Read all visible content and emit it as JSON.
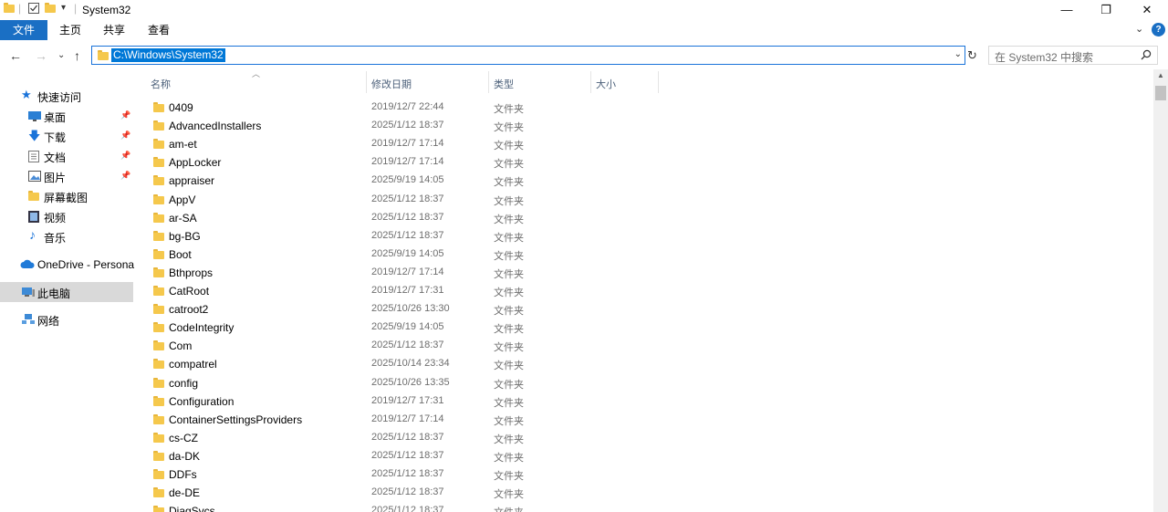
{
  "window": {
    "title": "System32",
    "minimize_glyph": "—",
    "maximize_glyph": "❐",
    "close_glyph": "✕"
  },
  "ribbon": {
    "tabs": [
      "文件",
      "主页",
      "共享",
      "查看"
    ],
    "help_label": "?"
  },
  "address": {
    "path": "C:\\Windows\\System32",
    "search_placeholder": "在 System32 中搜索"
  },
  "sidebar": {
    "items": [
      {
        "label": "快速访问",
        "icon": "star-icon"
      },
      {
        "label": "桌面",
        "icon": "desktop-icon",
        "pinned": true
      },
      {
        "label": "下载",
        "icon": "download-icon",
        "pinned": true
      },
      {
        "label": "文档",
        "icon": "document-icon",
        "pinned": true
      },
      {
        "label": "图片",
        "icon": "picture-icon",
        "pinned": true
      },
      {
        "label": "屏幕截图",
        "icon": "folder-icon"
      },
      {
        "label": "视频",
        "icon": "video-icon"
      },
      {
        "label": "音乐",
        "icon": "music-icon"
      },
      {
        "label": "OneDrive - Persona",
        "icon": "cloud-icon"
      },
      {
        "label": "此电脑",
        "icon": "computer-icon",
        "selected": true
      },
      {
        "label": "网络",
        "icon": "network-icon"
      }
    ]
  },
  "columns": [
    "名称",
    "修改日期",
    "类型",
    "大小"
  ],
  "files": [
    {
      "name": "0409",
      "date": "2019/12/7 22:44",
      "type": "文件夹"
    },
    {
      "name": "AdvancedInstallers",
      "date": "2025/1/12 18:37",
      "type": "文件夹"
    },
    {
      "name": "am-et",
      "date": "2019/12/7 17:14",
      "type": "文件夹"
    },
    {
      "name": "AppLocker",
      "date": "2019/12/7 17:14",
      "type": "文件夹"
    },
    {
      "name": "appraiser",
      "date": "2025/9/19 14:05",
      "type": "文件夹"
    },
    {
      "name": "AppV",
      "date": "2025/1/12 18:37",
      "type": "文件夹"
    },
    {
      "name": "ar-SA",
      "date": "2025/1/12 18:37",
      "type": "文件夹"
    },
    {
      "name": "bg-BG",
      "date": "2025/1/12 18:37",
      "type": "文件夹"
    },
    {
      "name": "Boot",
      "date": "2025/9/19 14:05",
      "type": "文件夹"
    },
    {
      "name": "Bthprops",
      "date": "2019/12/7 17:14",
      "type": "文件夹"
    },
    {
      "name": "CatRoot",
      "date": "2019/12/7 17:31",
      "type": "文件夹"
    },
    {
      "name": "catroot2",
      "date": "2025/10/26 13:30",
      "type": "文件夹"
    },
    {
      "name": "CodeIntegrity",
      "date": "2025/9/19 14:05",
      "type": "文件夹"
    },
    {
      "name": "Com",
      "date": "2025/1/12 18:37",
      "type": "文件夹"
    },
    {
      "name": "compatrel",
      "date": "2025/10/14 23:34",
      "type": "文件夹"
    },
    {
      "name": "config",
      "date": "2025/10/26 13:35",
      "type": "文件夹"
    },
    {
      "name": "Configuration",
      "date": "2019/12/7 17:31",
      "type": "文件夹"
    },
    {
      "name": "ContainerSettingsProviders",
      "date": "2019/12/7 17:14",
      "type": "文件夹"
    },
    {
      "name": "cs-CZ",
      "date": "2025/1/12 18:37",
      "type": "文件夹"
    },
    {
      "name": "da-DK",
      "date": "2025/1/12 18:37",
      "type": "文件夹"
    },
    {
      "name": "DDFs",
      "date": "2025/1/12 18:37",
      "type": "文件夹"
    },
    {
      "name": "de-DE",
      "date": "2025/1/12 18:37",
      "type": "文件夹"
    },
    {
      "name": "DiagSvcs",
      "date": "2025/1/12 18:37",
      "type": "文件夹"
    }
  ],
  "colors": {
    "accent": "#1a6fc4",
    "selection": "#0078d7",
    "folder": "#f5c84c"
  }
}
